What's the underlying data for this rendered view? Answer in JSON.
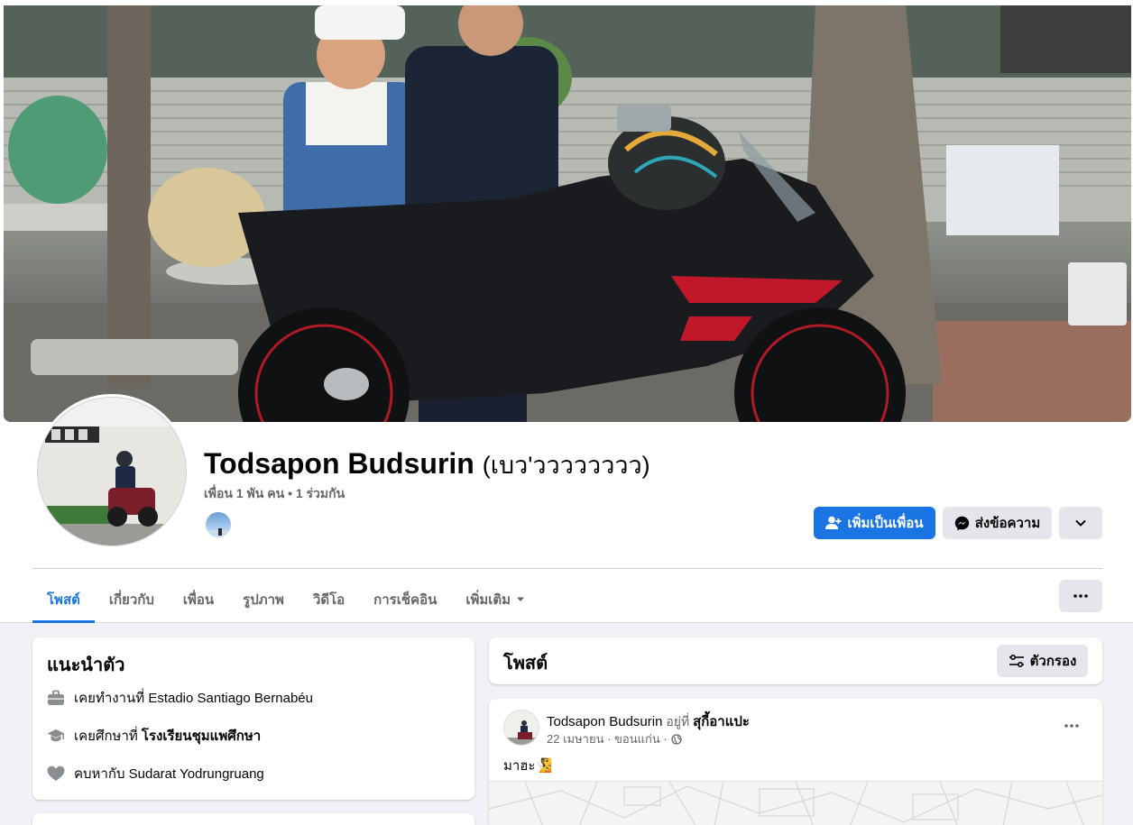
{
  "profile": {
    "name": "Todsapon Budsurin",
    "alt_name": "(เบว'วววววววว)",
    "friend_info": "เพื่อน 1 พัน คน • 1 ร่วมกัน"
  },
  "actions": {
    "add_friend": "เพิ่มเป็นเพื่อน",
    "message": "ส่งข้อความ"
  },
  "tabs": [
    {
      "label": "โพสต์",
      "active": true
    },
    {
      "label": "เกี่ยวกับ"
    },
    {
      "label": "เพื่อน"
    },
    {
      "label": "รูปภาพ"
    },
    {
      "label": "วิดีโอ"
    },
    {
      "label": "การเช็คอิน"
    },
    {
      "label": "เพิ่มเติม"
    }
  ],
  "intro": {
    "title": "แนะนำตัว",
    "items": [
      {
        "icon": "briefcase-icon",
        "prefix": "เคยทำงานที่ ",
        "value": "Estadio Santiago Bernabéu"
      },
      {
        "icon": "graduation-cap-icon",
        "prefix": "เคยศึกษาที่ ",
        "value": "โรงเรียนชุมแพศึกษา"
      },
      {
        "icon": "heart-icon",
        "prefix": "คบหากับ ",
        "value": "Sudarat Yodrungruang"
      }
    ]
  },
  "posts_section": {
    "title": "โพสต์",
    "filter_label": "ตัวกรอง"
  },
  "post": {
    "author": "Todsapon Budsurin",
    "at_text": " อยู่ที่ ",
    "place": "สุกี้อาแปะ",
    "meta": "22 เมษายน · ขอนแก่น ·",
    "text": "มาฮะ🧏"
  },
  "colors": {
    "primary": "#1b74e4",
    "background": "#f0f2f5",
    "secondary_button": "#e4e6eb",
    "muted_text": "#65676b"
  }
}
